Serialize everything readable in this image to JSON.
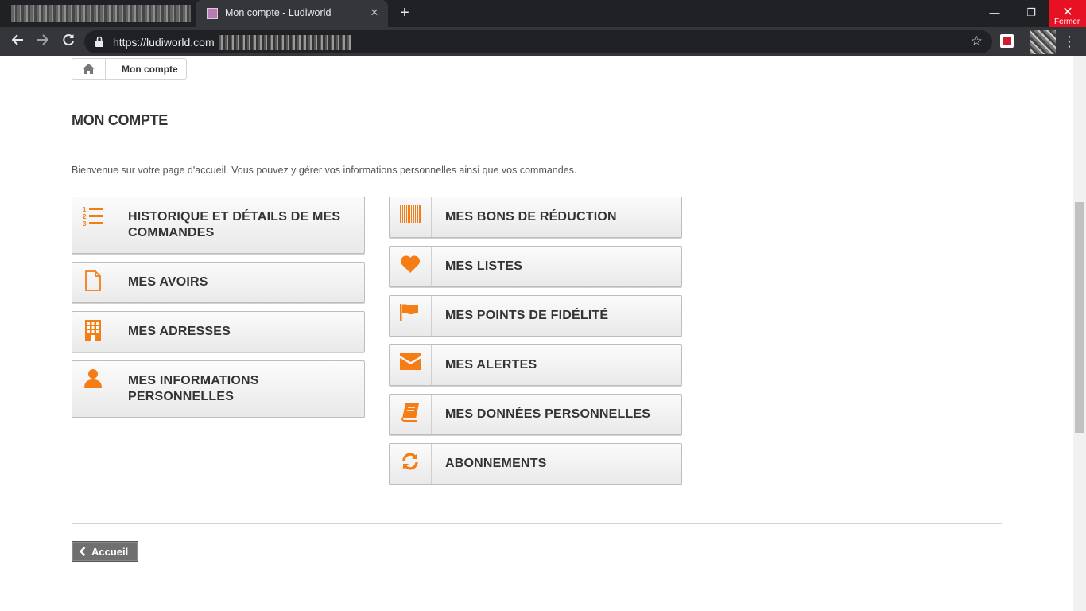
{
  "browser": {
    "tab": {
      "title": "Mon compte - Ludiworld"
    },
    "address": {
      "url": "https://ludiworld.com"
    },
    "window": {
      "close_label": "Fermer"
    }
  },
  "breadcrumb": {
    "current": "Mon compte"
  },
  "page": {
    "title": "MON COMPTE",
    "intro": "Bienvenue sur votre page d'accueil. Vous pouvez y gérer vos informations personnelles ainsi que vos commandes."
  },
  "account_links": {
    "left": [
      {
        "label": "HISTORIQUE ET DÉTAILS DE MES COMMANDES",
        "icon": "ordered-list-icon"
      },
      {
        "label": "MES AVOIRS",
        "icon": "file-icon"
      },
      {
        "label": "MES ADRESSES",
        "icon": "building-icon"
      },
      {
        "label": "MES INFORMATIONS PERSONNELLES",
        "icon": "user-icon"
      }
    ],
    "right": [
      {
        "label": "MES BONS DE RÉDUCTION",
        "icon": "barcode-icon"
      },
      {
        "label": "MES LISTES",
        "icon": "heart-icon"
      },
      {
        "label": "MES POINTS DE FIDÉLITÉ",
        "icon": "flag-icon"
      },
      {
        "label": "MES ALERTES",
        "icon": "envelope-icon"
      },
      {
        "label": "MES DONNÉES PERSONNELLES",
        "icon": "book-icon"
      },
      {
        "label": "ABONNEMENTS",
        "icon": "refresh-icon"
      }
    ]
  },
  "footer": {
    "back_label": "Accueil"
  },
  "colors": {
    "accent": "#f57d16",
    "chrome": "#35363a",
    "close": "#e81123"
  }
}
